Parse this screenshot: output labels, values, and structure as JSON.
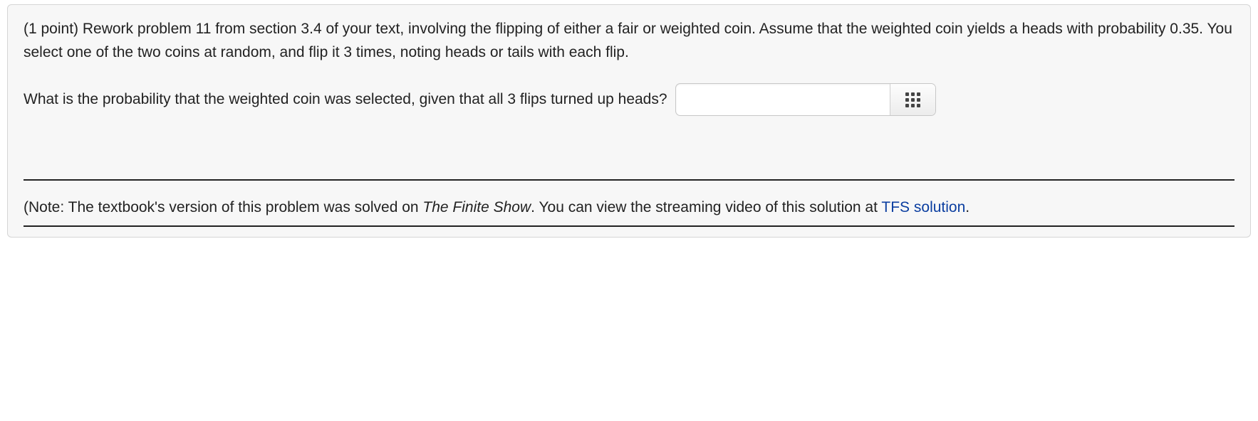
{
  "problem": {
    "intro": "(1 point) Rework problem 11 from section 3.4 of your text, involving the flipping of either a fair or weighted coin. Assume that the weighted coin yields a heads with probability 0.35. You select one of the two coins at random, and flip it 3 times, noting heads or tails with each flip.",
    "question": "What is the probability that the weighted coin was selected, given that all 3 flips turned up heads?",
    "answer_value": "",
    "answer_placeholder": ""
  },
  "note": {
    "prefix": "(Note: The textbook's version of this problem was solved on ",
    "show_title": "The Finite Show",
    "middle": ". You can view the streaming video of this solution at ",
    "link_text": "TFS solution",
    "suffix": "."
  },
  "icons": {
    "keypad": "keypad-icon"
  }
}
